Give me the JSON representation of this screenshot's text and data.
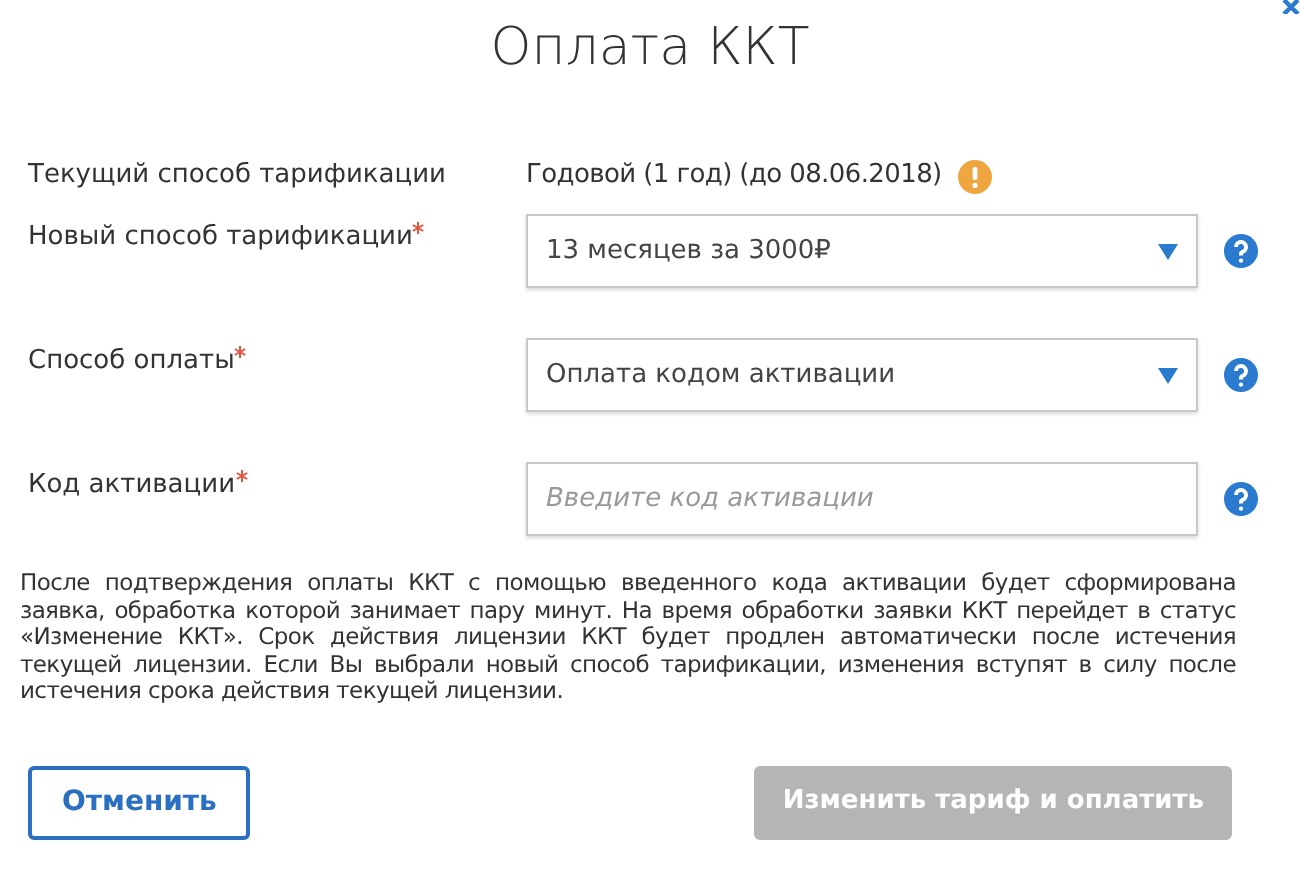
{
  "dialog": {
    "title": "Оплата ККТ"
  },
  "current": {
    "label": "Текущий способ тарификации",
    "value": "Годовой (1 год) (до 08.06.2018)",
    "warning": true
  },
  "fields": [
    {
      "kind": "select",
      "label": "Новый способ тарификации",
      "required": true,
      "value": "13 месяцев за 3000₽"
    },
    {
      "kind": "select",
      "label": "Способ оплаты",
      "required": true,
      "value": "Оплата кодом активации"
    },
    {
      "kind": "text",
      "label": "Код активации",
      "required": true,
      "placeholder": "Введите код активации"
    }
  ],
  "note": "После подтверждения оплаты ККТ с помощью введенного кода активации будет сформирована заявка, обработка которой занимает пару минут. На время обработки заявки ККТ перейдет в статус «Изменение ККТ». Срок действия лицензии ККТ будет продлен автоматически после истечения текущей лицензии. Если Вы выбрали новый способ тарификации, изменения вступят в силу после истечения срока действия текущей лицензии.",
  "buttons": [
    {
      "kind": "secondary",
      "label": "Отменить",
      "disabled": false
    },
    {
      "kind": "primary",
      "label": "Изменить тариф и оплатить",
      "disabled": true
    }
  ]
}
